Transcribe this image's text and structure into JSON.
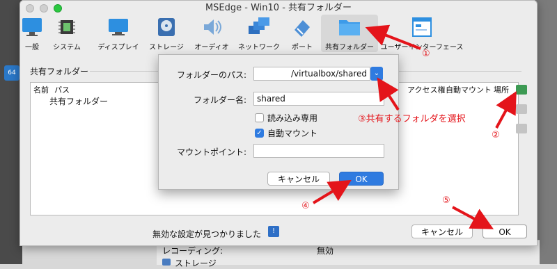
{
  "window": {
    "title": "MSEdge - Win10 - 共有フォルダー",
    "toolbar": [
      {
        "key": "general",
        "label": "一般"
      },
      {
        "key": "system",
        "label": "システム"
      },
      {
        "key": "display",
        "label": "ディスプレイ"
      },
      {
        "key": "storage",
        "label": "ストレージ"
      },
      {
        "key": "audio",
        "label": "オーディオ"
      },
      {
        "key": "network",
        "label": "ネットワーク"
      },
      {
        "key": "port",
        "label": "ポート"
      },
      {
        "key": "shared",
        "label": "共有フォルダー"
      },
      {
        "key": "ui",
        "label": "ユーザーインターフェース"
      }
    ]
  },
  "shared_panel": {
    "group_title": "共有フォルダー",
    "columns": {
      "name": "名前",
      "path": "パス",
      "access": "アクセス権",
      "auto": "自動マウント",
      "place": "場所"
    },
    "rows": [
      "共有フォルダー"
    ]
  },
  "dialog": {
    "path_label": "フォルダーのパス:",
    "path_value": "/virtualbox/shared",
    "name_label": "フォルダー名:",
    "name_value": "shared",
    "readonly_label": "読み込み専用",
    "readonly_checked": false,
    "automount_label": "自動マウント",
    "automount_checked": true,
    "mountpoint_label": "マウントポイント:",
    "mountpoint_value": "",
    "cancel": "キャンセル",
    "ok": "OK"
  },
  "footer": {
    "warning": "無効な設定が見つかりました",
    "cancel": "キャンセル",
    "ok": "OK"
  },
  "background": {
    "recording_label": "レコーディング:",
    "recording_value": "無効",
    "storage_label": "ストレージ",
    "tile_label": "64"
  },
  "annotations": {
    "a1": "①",
    "a2": "②",
    "a3": "③共有するフォルダを選択",
    "a4": "④",
    "a5": "⑤"
  },
  "colors": {
    "annotation": "#e4141a",
    "accent": "#2f7be0"
  }
}
